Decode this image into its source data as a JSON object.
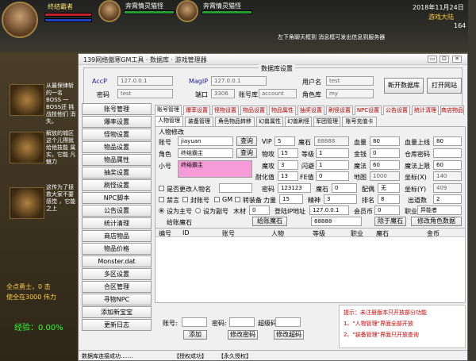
{
  "game": {
    "player1": "终结霸者",
    "player2": "奔霄情灵猫怪",
    "player3": "奔霄情灵猫怪",
    "datetime": "2018年11月24日",
    "server": "游戏大陆",
    "level": "164",
    "notice": "左下角聊天框到 消息框可发出信息到服务器",
    "left_text_1": "从最保律斩 的一名BOSS 一BOSS还 挑战技他们 消失。",
    "left_text_2": "解放的城区 这个儿得就 给他技能 属实，它能 凡魅力",
    "left_text_3": "这传为了拯 救大家不要 感觉 ，它能 之上",
    "chat_1": "全点勇士，0 击",
    "chat_2": "使全在3000 伟力",
    "exp": "经验：0.00%"
  },
  "window": {
    "title": "139网络傲寒GM工具 · 数据库 · 游戏管理器",
    "btn_min": "▭",
    "btn_max": "⊡",
    "btn_close": "✕"
  },
  "server": {
    "legend": "数据库设置",
    "accp_label": "AccP",
    "accp_value": "127.0.0.1",
    "magip_label": "MagIP",
    "magip_value": "127.0.0.1",
    "user_label": "用户名",
    "user_value": "test",
    "pwd_label": "密码",
    "pwd_value": "test",
    "port_label": "端口",
    "port_value": "3306",
    "acctdb_label": "账号库",
    "acctdb_value": "account",
    "roledb_label": "角色库",
    "roledb_value": "my",
    "open_db": "断开数据库",
    "open_site": "打开网站"
  },
  "menu": [
    "账号管理",
    "爆率设置",
    "怪物设置",
    "物品设置",
    "物品属性",
    "抽奖设置",
    "刷怪设置",
    "NPC脚本",
    "公告设置",
    "统计清理",
    "商店物品",
    "物品价格",
    "Monster.dat",
    "多区设置",
    "合区管理",
    "寻物NPC",
    "添加新宝宝",
    "更新日志"
  ],
  "tabs": [
    "账号管理",
    "爆率设置",
    "怪物设置",
    "物品设置",
    "物品属性",
    "抽奖设置",
    "刷怪设置",
    "NPC设置",
    "公告设置",
    "统计清理",
    "商店物品"
  ],
  "subtabs": [
    "人物管理",
    "装备管理",
    "角色物品转移",
    "幻兽属性",
    "幻兽刷怪",
    "军团管理",
    "账号充值卡"
  ],
  "role": {
    "group": "人物修改",
    "account_label": "账号",
    "account_value": "jiayuan",
    "query1": "查询",
    "vip_label": "VIP",
    "vip_value": "5",
    "magic_stone_label": "魔石",
    "magic_stone_value": "88888",
    "hp_label": "血量",
    "hp_value": "80",
    "hpmax_label": "血量上线",
    "hpmax_value": "80",
    "role_label": "角色",
    "role_value": "终结霸主",
    "query2": "查询",
    "phys_attack_label": "物攻",
    "phys_attack_value": "15",
    "equip_label": "等级",
    "equip_value": "1",
    "gold_label": "金钱",
    "gold_value": "0",
    "warehouse_label": "仓库密码",
    "warehouse_value": "",
    "nick_label": "小号",
    "nick_value": "终结霸主",
    "magic_attack_label": "魔攻",
    "magic_attack_value": "3",
    "dodge_label": "闪避",
    "dodge_value": "1",
    "mp_label": "魔法",
    "mp_value": "60",
    "mpmax_label": "魔法上限",
    "mpmax_value": "60",
    "spirit_label": "耐化值",
    "spirit_value": "13",
    "fame_label": "FE值",
    "fame_value": "0",
    "map_label": "地图",
    "map_value": "1000",
    "coordx_label": "坐标(X)",
    "coordx_value": "140",
    "gm_check_1": "是否更改人物名",
    "pwd2_label": "密码",
    "pwd2_value": "123123",
    "repute_label": "魔石",
    "repute_value": "0",
    "faction_label": "配偶",
    "faction_value": "无",
    "coordy_label": "坐标(Y)",
    "coordy_value": "409",
    "ban_label": "禁言",
    "freeze_label": "封账号",
    "gm_label": "GM",
    "sw_label": "转装备",
    "str_label": "力量",
    "str_value": "15",
    "spirit2_label": "精神",
    "spirit2_value": "3",
    "rank_label": "排名",
    "rank_value": "8",
    "bday_label": "出道数",
    "bday_value": "2",
    "set_main_label": "设为主号",
    "set_sub_label": "设为副号",
    "wood_label": "木材",
    "wood_value": "0",
    "login_ip_label": "登陆IP地址",
    "login_ip_value": "127.0.0.1",
    "member_label": "会员币",
    "member_value": "0",
    "job_label": "职业",
    "job_value": "异能者",
    "add_stone_label": "给账魔石",
    "add_stone_btn": "给账魔石",
    "add_stone_value": "88888",
    "remove_nick_btn": "除于魔石",
    "save_btn": "修改角色数据"
  },
  "table": {
    "cols": [
      "编号",
      "ID",
      "账号",
      "人物",
      "等级",
      "职业",
      "魔石",
      "金币"
    ]
  },
  "bottom": {
    "acct_label": "账号:",
    "pwd_label": "密码:",
    "extra_label": "超级码",
    "add_btn": "添加",
    "edit_pwd_btn": "修改密码",
    "edit_extra_btn": "修改超码",
    "note_title": "提示：未注册版本只开放部分功能",
    "note_1": "1、\"人物管理\"界面全部开放",
    "note_2": "2、\"装备管理\"界面只开放查询"
  },
  "status": {
    "db_state": "数据库连接成功.......",
    "auth_ok": "【授权成功】",
    "auth_type": "【永久授权】"
  }
}
